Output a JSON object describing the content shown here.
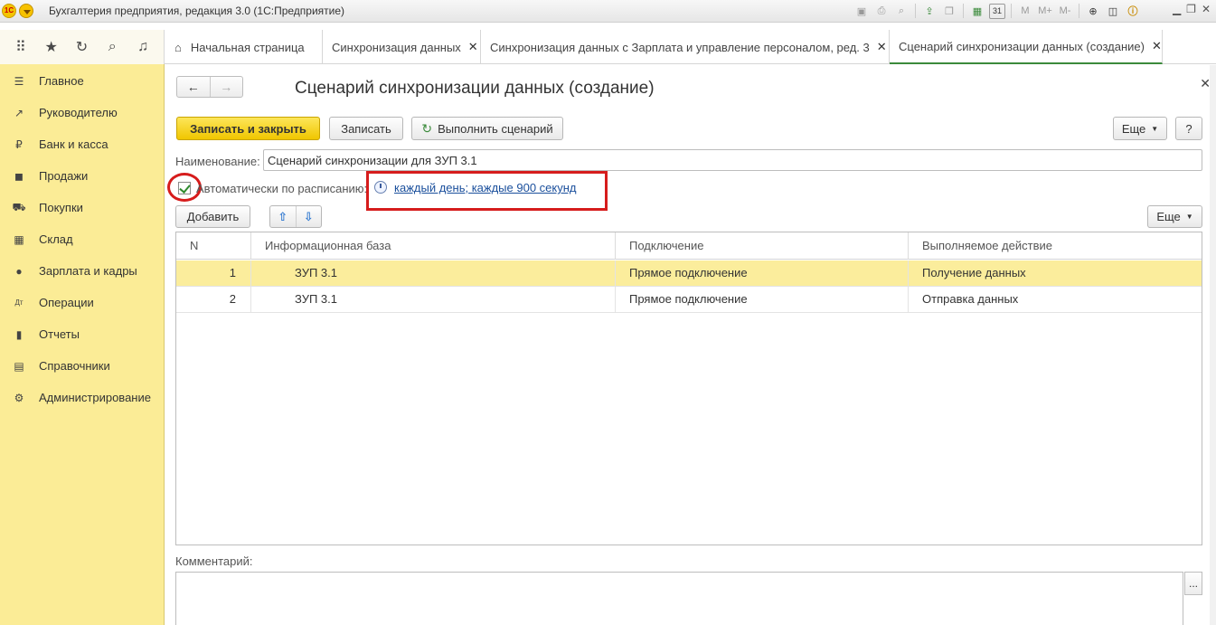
{
  "window": {
    "logo_text": "1С",
    "title": "Бухгалтерия предприятия, редакция 3.0  (1С:Предприятие)",
    "toolbar_icons": [
      "save-icon",
      "print-icon",
      "preview-icon",
      "upload-icon",
      "copy-icon",
      "calculator-icon",
      "calendar-icon",
      "m-icon",
      "m-plus-icon",
      "m-minus-icon",
      "zoom-icon",
      "window-icon",
      "info-icon"
    ],
    "memory_labels": [
      "M",
      "M+",
      "M-"
    ],
    "calendar_day": "31"
  },
  "quick_icons": [
    "apps-grid-icon",
    "star-icon",
    "history-icon",
    "search-icon",
    "bell-icon"
  ],
  "tabs": [
    {
      "label": "Начальная страница",
      "closable": false,
      "home": true
    },
    {
      "label": "Синхронизация данных",
      "closable": true
    },
    {
      "label": "Синхронизация данных с Зарплата и управление персоналом, ред. 3",
      "closable": true
    },
    {
      "label": "Сценарий синхронизации данных (создание)",
      "closable": true,
      "active": true
    }
  ],
  "sidebar": {
    "items": [
      {
        "label": "Главное",
        "icon": "menu-icon"
      },
      {
        "label": "Руководителю",
        "icon": "trend-icon"
      },
      {
        "label": "Банк и касса",
        "icon": "ruble-icon"
      },
      {
        "label": "Продажи",
        "icon": "bag-icon"
      },
      {
        "label": "Покупки",
        "icon": "cart-icon"
      },
      {
        "label": "Склад",
        "icon": "warehouse-icon"
      },
      {
        "label": "Зарплата и кадры",
        "icon": "person-icon"
      },
      {
        "label": "Операции",
        "icon": "dt-kt-icon"
      },
      {
        "label": "Отчеты",
        "icon": "bar-chart-icon"
      },
      {
        "label": "Справочники",
        "icon": "book-icon"
      },
      {
        "label": "Администрирование",
        "icon": "gear-icon"
      }
    ]
  },
  "form": {
    "title": "Сценарий синхронизации данных (создание)",
    "buttons": {
      "save_close": "Записать и закрыть",
      "save": "Записать",
      "run": "Выполнить сценарий",
      "more": "Еще",
      "help": "?",
      "add": "Добавить",
      "more2": "Еще"
    },
    "name_label": "Наименование:",
    "name_value": "Сценарий синхронизации для ЗУП 3.1",
    "auto_label": "Автоматически по расписанию:",
    "auto_checked": true,
    "schedule_link": "каждый день; каждые 900 секунд",
    "table": {
      "columns": [
        "N",
        "Информационная база",
        "Подключение",
        "Выполняемое действие"
      ],
      "rows": [
        {
          "n": "1",
          "base": "ЗУП 3.1",
          "conn": "Прямое подключение",
          "action": "Получение данных"
        },
        {
          "n": "2",
          "base": "ЗУП 3.1",
          "conn": "Прямое подключение",
          "action": "Отправка данных"
        }
      ]
    },
    "comment_label": "Комментарий:",
    "comment_btn": "...",
    "highlight_colors": {
      "annotation_red": "#d61c1c",
      "selected_row": "#fbed9c",
      "sidebar_bg": "#fbec96"
    }
  }
}
